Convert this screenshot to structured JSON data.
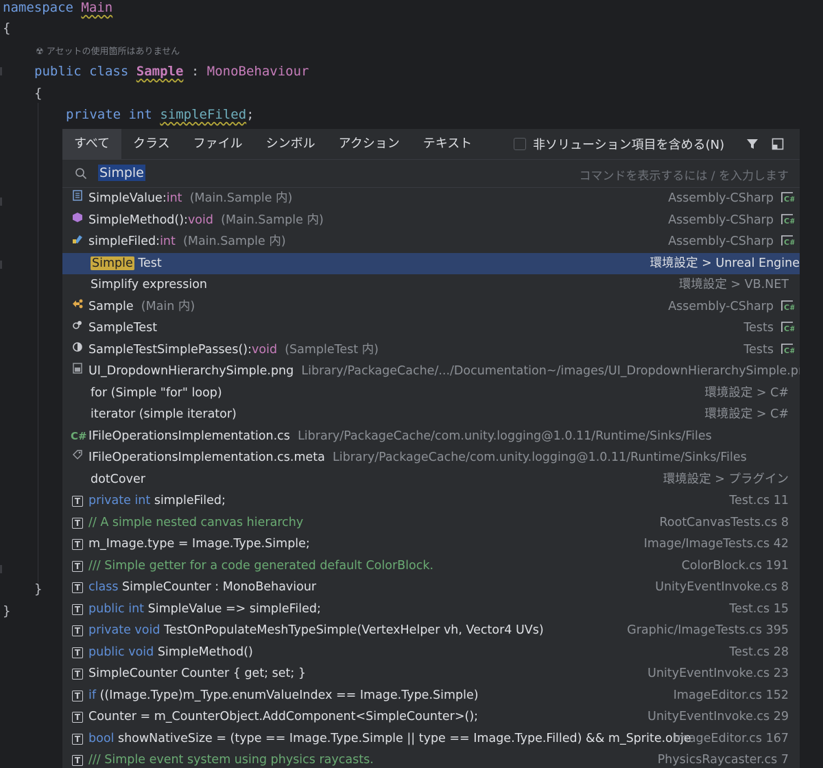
{
  "editor": {
    "namespace_kw": "namespace",
    "namespace_name": "Main",
    "open_brace": "{",
    "usage_hint": "アセットの使用箇所はありません",
    "class_public": "public",
    "class_kw": "class",
    "class_name": "Sample",
    "colon": ":",
    "base_class": "MonoBehaviour",
    "class_open": "{",
    "field_private": "private",
    "field_type": "int",
    "field_name": "simpleFiled",
    "semicolon": ";",
    "class_close": "}",
    "ns_close": "}"
  },
  "popup": {
    "tabs": [
      {
        "label": "すべて",
        "active": true
      },
      {
        "label": "クラス"
      },
      {
        "label": "ファイル"
      },
      {
        "label": "シンボル"
      },
      {
        "label": "アクション"
      },
      {
        "label": "テキスト"
      }
    ],
    "include_non_solution_label": "非ソリューション項目を含める(N)",
    "include_non_solution_checked": false,
    "search": {
      "value": "Simple",
      "placeholder": "コマンドを表示するには / を入力します"
    },
    "results": [
      {
        "icon": "property-icon",
        "name": "SimpleValue",
        "sep": ":",
        "type": "int",
        "context": "(Main.Sample 内)",
        "location": "Assembly-CSharp",
        "badge": "C#"
      },
      {
        "icon": "method-icon",
        "name": "SimpleMethod()",
        "sep": ":",
        "type": "void",
        "context": "(Main.Sample 内)",
        "location": "Assembly-CSharp",
        "badge": "C#"
      },
      {
        "icon": "field-icon",
        "name": "simpleFiled",
        "sep": ":",
        "type": "int",
        "context": "(Main.Sample 内)",
        "location": "Assembly-CSharp",
        "badge": "C#"
      },
      {
        "icon": "",
        "highlight": "Simple",
        "name": " Test",
        "location": "環境設定 > Unreal Engine",
        "selected": true
      },
      {
        "icon": "",
        "name": "Simplify expression",
        "location": "環境設定 > VB.NET"
      },
      {
        "icon": "class-icon",
        "name": "Sample",
        "context": "(Main 内)",
        "location": "Assembly-CSharp",
        "badge": "C#"
      },
      {
        "icon": "test-class-icon",
        "name": "SampleTest",
        "location": "Tests",
        "badge": "C#"
      },
      {
        "icon": "test-method-icon",
        "name": "SampleTestSimplePasses()",
        "sep": ":",
        "type": "void",
        "context": "(SampleTest 内)",
        "location": "Tests",
        "badge": "C#"
      },
      {
        "icon": "image-file-icon",
        "name": "UI_DropdownHierarchySimple.png",
        "context": "Library/PackageCache/.../Documentation~/images/UI_DropdownHierarchySimple.png",
        "location": ""
      },
      {
        "icon": "",
        "name": "for (Simple \"for\" loop)",
        "location": "環境設定 > C#"
      },
      {
        "icon": "",
        "name": "iterator (simple iterator)",
        "location": "環境設定 > C#"
      },
      {
        "icon": "csharp-file-icon",
        "name": "IFileOperationsImplementation.cs",
        "context": "Library/PackageCache/com.unity.logging@1.0.11/Runtime/Sinks/Files",
        "location": ""
      },
      {
        "icon": "meta-file-icon",
        "name": "IFileOperationsImplementation.cs.meta",
        "context": "Library/PackageCache/com.unity.logging@1.0.11/Runtime/Sinks/Files",
        "location": ""
      },
      {
        "icon": "",
        "name": "dotCover",
        "location": "環境設定 > プラグイン"
      },
      {
        "icon": "text-icon",
        "kw": "private int",
        "name": " simpleFiled;",
        "location": "Test.cs 11"
      },
      {
        "icon": "text-icon",
        "comment": "// A simple nested canvas hierarchy",
        "location": "RootCanvasTests.cs 8"
      },
      {
        "icon": "text-icon",
        "name": "m_Image.type = Image.Type.Simple;",
        "location": "Image/ImageTests.cs 42"
      },
      {
        "icon": "text-icon",
        "comment": "/// Simple getter for a code generated default ColorBlock.",
        "location": "ColorBlock.cs 191"
      },
      {
        "icon": "text-icon",
        "kw": "class",
        "name": " SimpleCounter : MonoBehaviour",
        "location": "UnityEventInvoke.cs 8"
      },
      {
        "icon": "text-icon",
        "kw": "public int",
        "name": " SimpleValue => simpleFiled;",
        "location": "Test.cs 15"
      },
      {
        "icon": "text-icon",
        "kw": "private void",
        "name": " TestOnPopulateMeshTypeSimple(VertexHelper vh, Vector4 UVs)",
        "location": "Graphic/ImageTests.cs 395"
      },
      {
        "icon": "text-icon",
        "kw": "public void",
        "name": " SimpleMethod()",
        "location": "Test.cs 28"
      },
      {
        "icon": "text-icon",
        "name": "SimpleCounter Counter { get; set; }",
        "location": "UnityEventInvoke.cs 23"
      },
      {
        "icon": "text-icon",
        "kw": "if",
        "name": " ((Image.Type)m_Type.enumValueIndex == Image.Type.Simple)",
        "location": "ImageEditor.cs 152"
      },
      {
        "icon": "text-icon",
        "name": "Counter = m_CounterObject.AddComponent<SimpleCounter>();",
        "location": "UnityEventInvoke.cs 29"
      },
      {
        "icon": "text-icon",
        "kw": "bool",
        "name": " showNativeSize = (type == Image.Type.Simple || type == Image.Type.Filled) && m_Sprite.obje",
        "location": "ImageEditor.cs 167"
      },
      {
        "icon": "text-icon",
        "comment": "/// Simple event system using physics raycasts.",
        "location": "PhysicsRaycaster.cs 7"
      }
    ]
  },
  "colors": {
    "background": "#1e1f22",
    "popup": "#2b2d30",
    "selection": "#2e436e",
    "highlight": "#c9a93f",
    "keyword": "#5f8fd8",
    "type": "#c77dbb",
    "comment": "#6aab73"
  }
}
